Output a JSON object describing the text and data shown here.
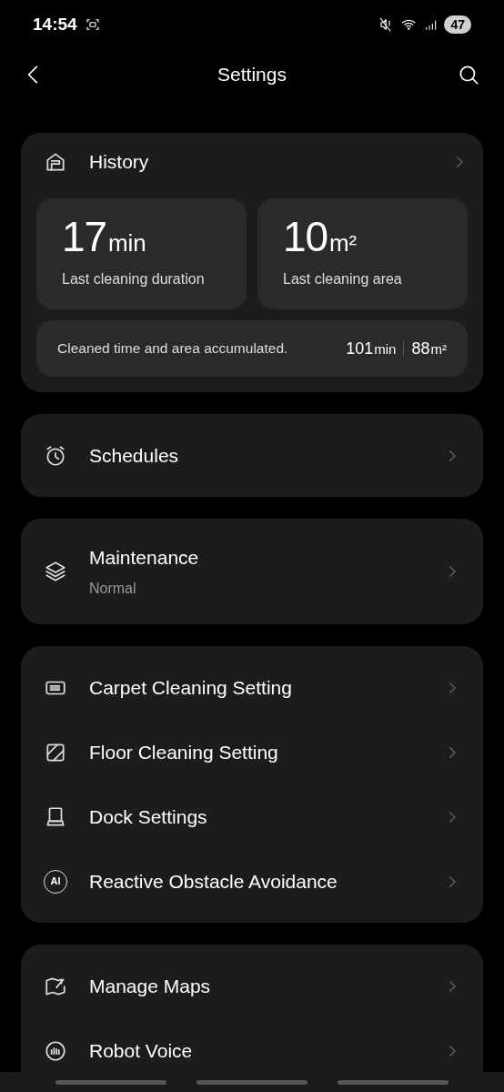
{
  "status_bar": {
    "time": "14:54",
    "battery": "47"
  },
  "header": {
    "title": "Settings"
  },
  "history": {
    "title": "History",
    "stats": [
      {
        "value": "17",
        "unit": "min",
        "label": "Last cleaning duration"
      },
      {
        "value": "10",
        "unit": "m²",
        "label": "Last cleaning area"
      }
    ],
    "accumulated": {
      "label": "Cleaned time and area accumulated.",
      "time_value": "101",
      "time_unit": "min",
      "area_value": "88",
      "area_unit": "m²"
    }
  },
  "groups": [
    {
      "items": [
        {
          "kind": "alarm",
          "label": "Schedules"
        }
      ]
    },
    {
      "items": [
        {
          "kind": "layers",
          "label": "Maintenance",
          "subtitle": "Normal"
        }
      ]
    },
    {
      "items": [
        {
          "kind": "carpet",
          "label": "Carpet Cleaning Setting"
        },
        {
          "kind": "floor",
          "label": "Floor Cleaning Setting"
        },
        {
          "kind": "dock",
          "label": "Dock Settings"
        },
        {
          "kind": "ai",
          "icon_text": "AI",
          "label": "Reactive Obstacle Avoidance"
        }
      ]
    },
    {
      "items": [
        {
          "kind": "map",
          "label": "Manage Maps"
        },
        {
          "kind": "voice",
          "label": "Robot Voice"
        }
      ]
    }
  ]
}
